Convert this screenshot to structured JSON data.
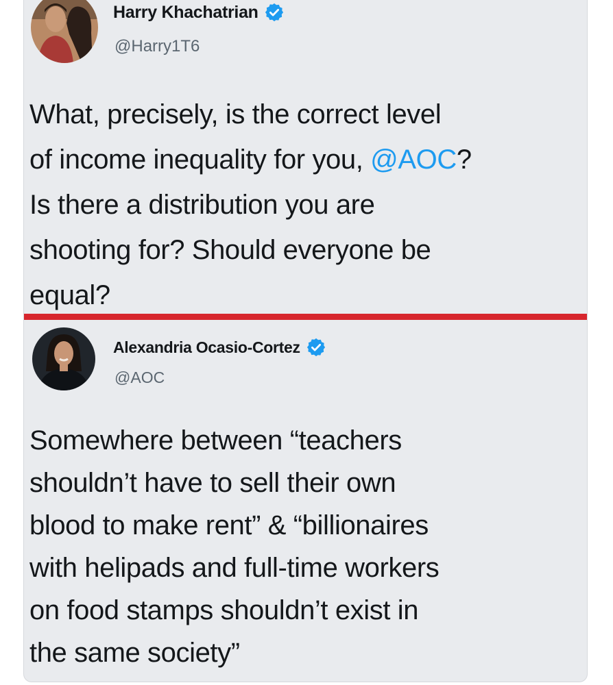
{
  "tweets": [
    {
      "display_name": "Harry Khachatrian",
      "handle": "@Harry1T6",
      "body_lines": [
        "What, precisely, is the correct level",
        "of income inequality for you, ",
        "Is there a distribution you are",
        "shooting for? Should everyone be",
        "equal?"
      ],
      "mention": "@AOC",
      "mention_suffix": "?",
      "avatar_icon": "profile-photo-icon",
      "verified_icon": "verified-badge-icon"
    },
    {
      "display_name": "Alexandria Ocasio-Cortez",
      "handle": "@AOC",
      "body_lines": [
        "Somewhere between “teachers",
        "shouldn’t have to sell their own",
        "blood to make rent” & “billionaires",
        "with helipads and full-time workers",
        "on food stamps shouldn’t exist in",
        "the same society”"
      ],
      "avatar_icon": "profile-photo-icon",
      "verified_icon": "verified-badge-icon"
    }
  ],
  "colors": {
    "background": "#e9ebee",
    "text": "#14171a",
    "handle": "#5b6670",
    "mention": "#1d9bf0",
    "verified": "#1d9bf0",
    "divider": "#d7262d"
  }
}
